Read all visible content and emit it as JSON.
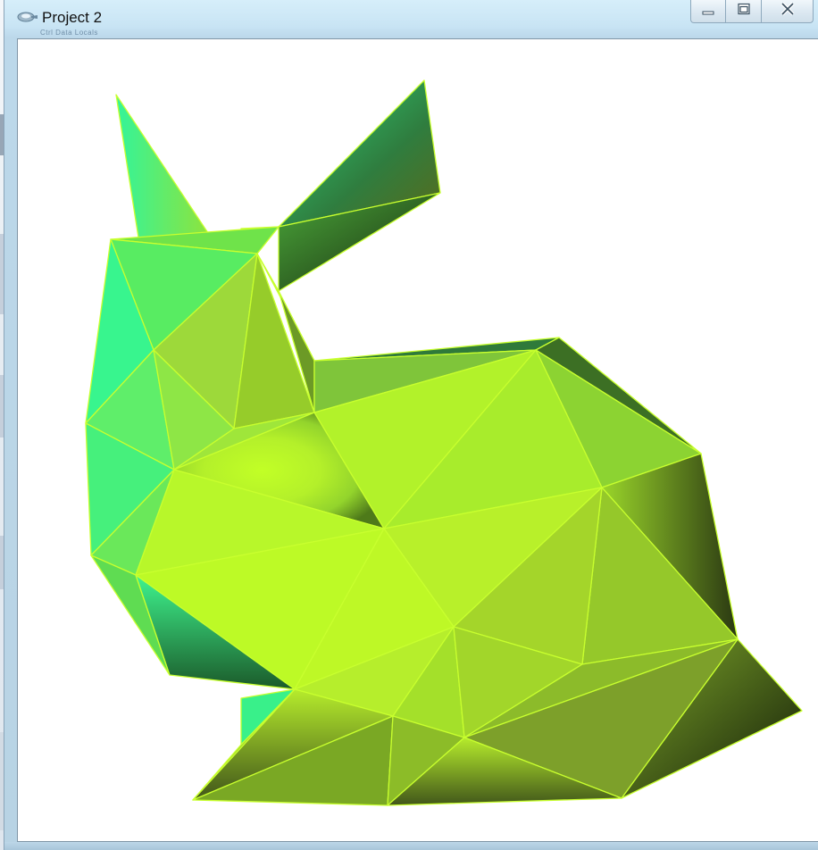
{
  "window": {
    "title": "Project 2",
    "ghost_menu": "Ctrl Data Locals"
  },
  "icons": {
    "app": "app-icon",
    "minimize": "minimize-icon",
    "maximize": "maximize-icon",
    "close": "close-icon"
  },
  "colors": {
    "mesh_edge": "#c8ff2e",
    "mesh_bright": "#c0ff28",
    "mesh_teal": "#35f59a",
    "mesh_dark": "#1a2a10",
    "client_bg": "#ffffff"
  }
}
